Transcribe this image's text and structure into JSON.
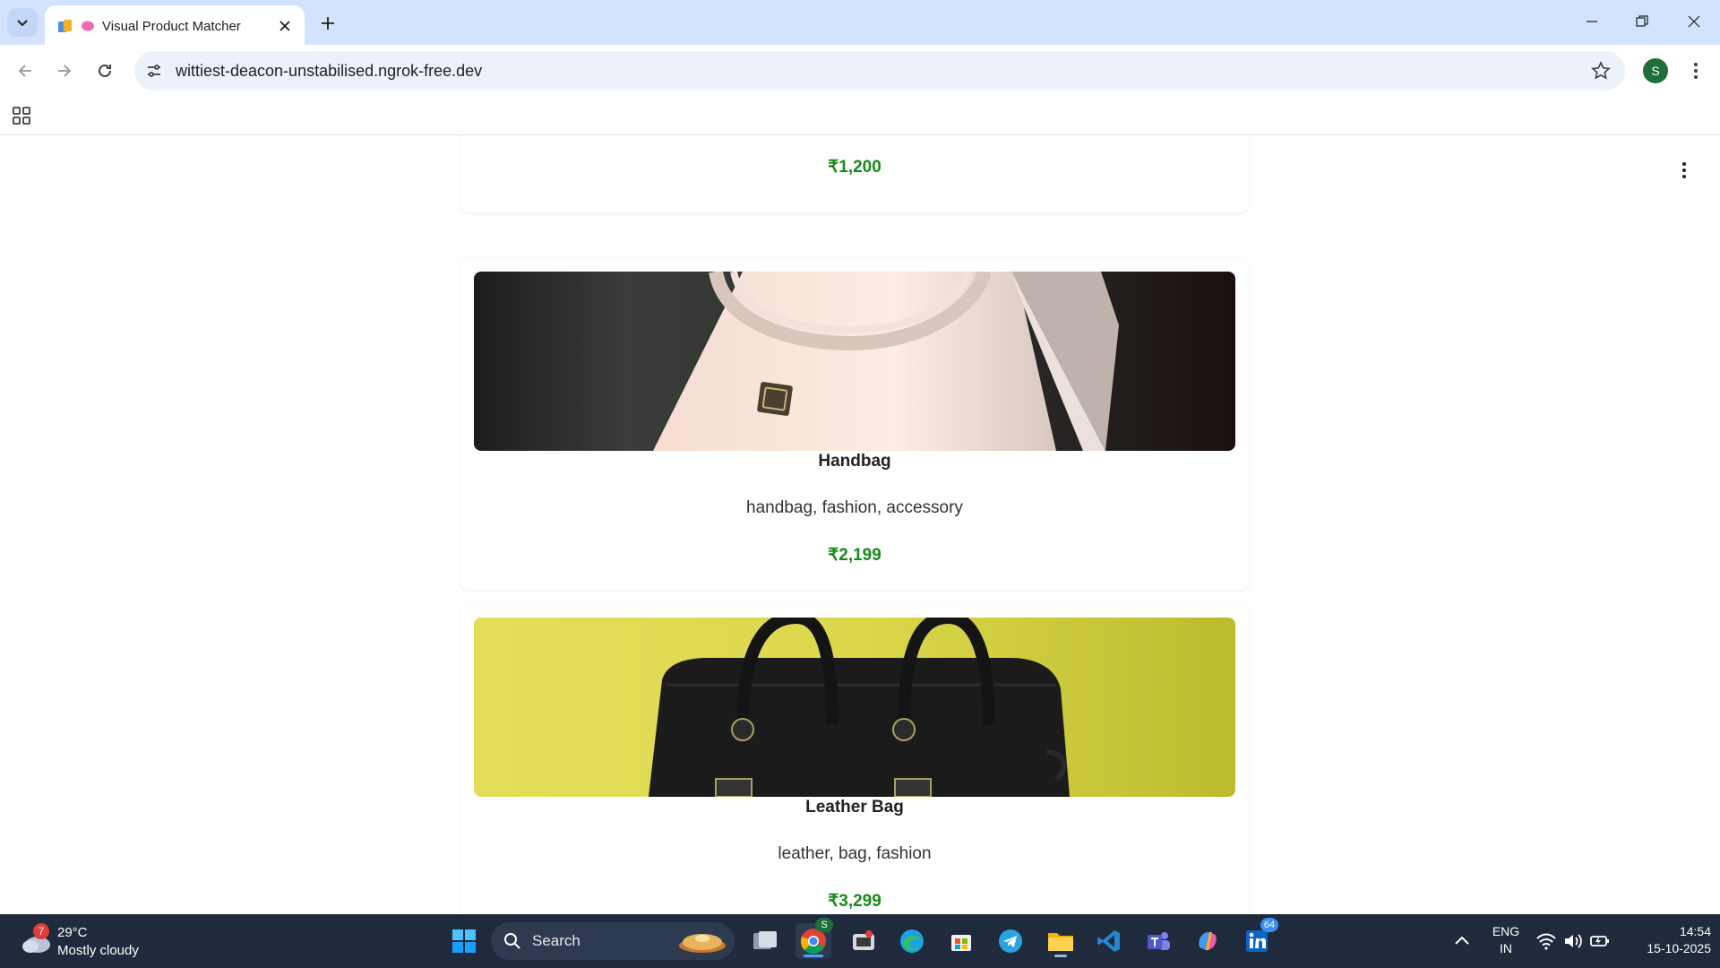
{
  "browser": {
    "tab_title": "Visual Product Matcher",
    "url": "wittiest-deacon-unstabilised.ngrok-free.dev",
    "profile_initial": "S"
  },
  "products": [
    {
      "price": "₹1,200"
    },
    {
      "name": "Handbag",
      "tags": "handbag, fashion, accessory",
      "price": "₹2,199",
      "image": "white-handbag-photo"
    },
    {
      "name": "Leather Bag",
      "tags": "leather, bag, fashion",
      "price": "₹3,299",
      "image": "black-leather-bag-photo"
    }
  ],
  "taskbar": {
    "weather_badge": "7",
    "weather_temp": "29°C",
    "weather_condition": "Mostly cloudy",
    "search_label": "Search",
    "language_line1": "ENG",
    "language_line2": "IN",
    "time": "14:54",
    "date": "15-10-2025",
    "chrome_badge": "S",
    "linkedin_badge": "64"
  },
  "colors": {
    "price_green": "#1a8a1a",
    "tab_strip": "#d3e3fd",
    "taskbar": "#1f2a3c"
  }
}
